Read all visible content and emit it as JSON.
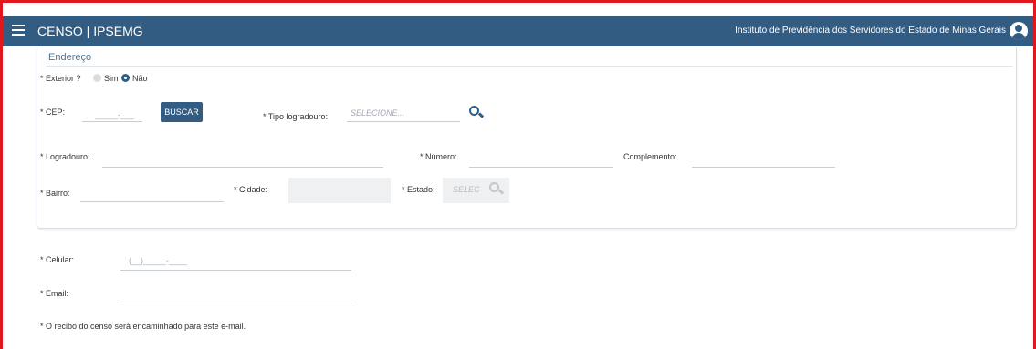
{
  "header": {
    "app_title": "CENSO | IPSEMG",
    "institute": "Instituto de Previdência dos Servidores do Estado de Minas Gerais"
  },
  "endereco": {
    "section_title": "Endereço",
    "exterior": {
      "label": "* Exterior ?",
      "options": [
        "Sim",
        "Não"
      ],
      "selected": "Não"
    },
    "cep": {
      "label": "* CEP:",
      "mask": "_____-___"
    },
    "buscar_label": "BUSCAR",
    "tipo_logradouro": {
      "label": "* Tipo logradouro:",
      "placeholder": "SELECIONE..."
    },
    "logradouro": {
      "label": "* Logradouro:"
    },
    "numero": {
      "label": "* Número:"
    },
    "complemento": {
      "label": "Complemento:"
    },
    "bairro": {
      "label": "* Bairro:"
    },
    "cidade": {
      "label": "* Cidade:"
    },
    "estado": {
      "label": "* Estado:",
      "placeholder": "SELEC"
    }
  },
  "contato": {
    "celular": {
      "label": "* Celular:",
      "mask": "(__)_____-____"
    },
    "email": {
      "label": "* Email:"
    },
    "note": "* O recibo do censo será encaminhado para este e-mail."
  },
  "colors": {
    "header_bg": "#335c82",
    "frame": "#e0181e",
    "accent": "#2d5f8e"
  }
}
